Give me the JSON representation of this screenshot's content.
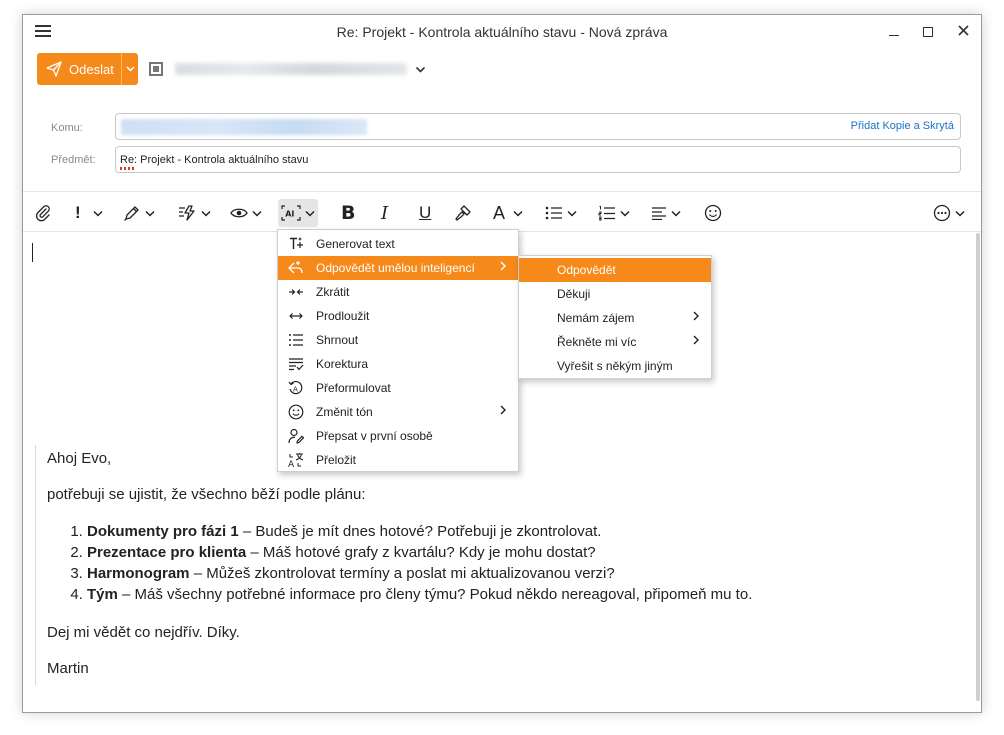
{
  "window": {
    "title": "Re: Projekt - Kontrola aktuálního stavu - Nová zpráva",
    "controls": {
      "minimize": "—",
      "maximize": "☐",
      "close": "✕"
    }
  },
  "send": {
    "label": "Odeslat"
  },
  "colors": {
    "accent": "#f5891a",
    "link": "#1a73c8"
  },
  "fields": {
    "to_label": "Komu:",
    "subject_label": "Předmět:",
    "add_cc_label": "Přidat Kopie a Skrytá",
    "subject_value": "Re: Projekt - Kontrola aktuálního stavu"
  },
  "toolbar": {
    "icons": [
      "paperclip-icon",
      "priority-icon",
      "pen-icon",
      "quick-actions-icon",
      "eye-icon",
      "ai-icon",
      "bold-icon",
      "italic-icon",
      "underline-icon",
      "paint-brush-icon",
      "font-color-icon",
      "bullet-list-icon",
      "numbered-list-icon",
      "align-icon",
      "emoji-icon",
      "more-icon"
    ],
    "bold": "B",
    "italic": "I",
    "underline": "U",
    "font": "A",
    "priority": "!"
  },
  "ai_menu": {
    "items": [
      {
        "label": "Generovat text",
        "icon": "generate-icon"
      },
      {
        "label": "Odpovědět umělou inteligencí",
        "icon": "ai-reply-icon",
        "submenu": true,
        "highlighted": true
      },
      {
        "label": "Zkrátit",
        "icon": "shorten-icon"
      },
      {
        "label": "Prodloužit",
        "icon": "lengthen-icon"
      },
      {
        "label": "Shrnout",
        "icon": "summarize-icon"
      },
      {
        "label": "Korektura",
        "icon": "proofread-icon"
      },
      {
        "label": "Přeformulovat",
        "icon": "rephrase-icon"
      },
      {
        "label": "Změnit tón",
        "icon": "smile-icon",
        "submenu": true
      },
      {
        "label": "Přepsat v první osobě",
        "icon": "person-edit-icon"
      },
      {
        "label": "Přeložit",
        "icon": "translate-icon"
      }
    ]
  },
  "reply_submenu": {
    "items": [
      {
        "label": "Odpovědět",
        "highlighted": true
      },
      {
        "label": "Děkuji"
      },
      {
        "label": "Nemám zájem",
        "submenu": true
      },
      {
        "label": "Řekněte mi víc",
        "submenu": true
      },
      {
        "label": "Vyřešit s někým jiným"
      }
    ]
  },
  "body": {
    "greeting": "Ahoj Evo,",
    "intro": "potřebuji se ujistit, že všechno běží podle plánu:",
    "list": [
      {
        "bold": "Dokumenty pro fázi 1",
        "rest": " – Budeš je mít dnes hotové? Potřebuji je zkontrolovat."
      },
      {
        "bold": "Prezentace pro klienta",
        "rest": " – Máš hotové grafy z kvartálu? Kdy je mohu dostat?"
      },
      {
        "bold": "Harmonogram",
        "rest": " – Můžeš zkontrolovat termíny a poslat mi aktualizovanou verzi?"
      },
      {
        "bold": "Tým",
        "rest": " – Máš všechny potřebné informace pro členy týmu? Pokud někdo nereagoval, připomeň mu to."
      }
    ],
    "closing": "Dej mi vědět co nejdřív. Díky.",
    "signature": "Martin"
  }
}
